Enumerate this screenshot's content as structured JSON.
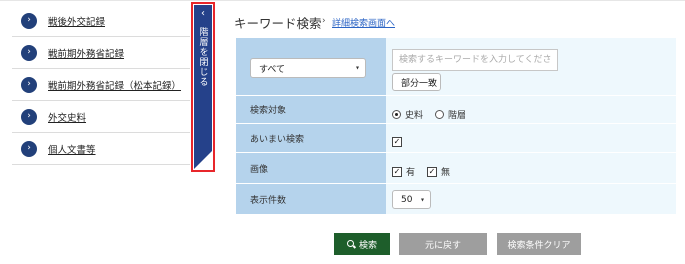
{
  "sidebar": {
    "items": [
      {
        "label": "戦後外交記録"
      },
      {
        "label": "戦前期外務省記録"
      },
      {
        "label": "戦前期外務省記録（松本記録）"
      },
      {
        "label": "外交史料"
      },
      {
        "label": "個人文書等"
      }
    ]
  },
  "toggle": {
    "label": "階層を閉じる",
    "chevron": "‹"
  },
  "header": {
    "title": "キーワード検索",
    "arrow": "›",
    "detail_link": "詳細検索画面へ"
  },
  "form": {
    "scope_select": {
      "value": "すべて"
    },
    "keyword": {
      "value": "",
      "placeholder": "検索するキーワードを入力してください"
    },
    "match_select": {
      "value": "部分一致"
    },
    "target": {
      "label": "検索対象",
      "options": [
        {
          "label": "史料",
          "selected": true
        },
        {
          "label": "階層",
          "selected": false
        }
      ]
    },
    "fuzzy": {
      "label": "あいまい検索",
      "checked": true
    },
    "image": {
      "label": "画像",
      "options": [
        {
          "label": "有",
          "checked": true
        },
        {
          "label": "無",
          "checked": true
        }
      ]
    },
    "count": {
      "label": "表示件数",
      "value": "50"
    }
  },
  "buttons": {
    "search": "検索",
    "back": "元に戻す",
    "clear": "検索条件クリア"
  },
  "glyphs": {
    "check": "✓",
    "caret": "▾",
    "bullet": "›"
  },
  "colors": {
    "accent_navy": "#25418a",
    "highlight_red": "#e8262b",
    "label_cell": "#b5d3ec",
    "form_bg": "#eef8fd",
    "search_button": "#1e5e2b",
    "secondary_button": "#9e9e9e",
    "link": "#2b64c5"
  }
}
